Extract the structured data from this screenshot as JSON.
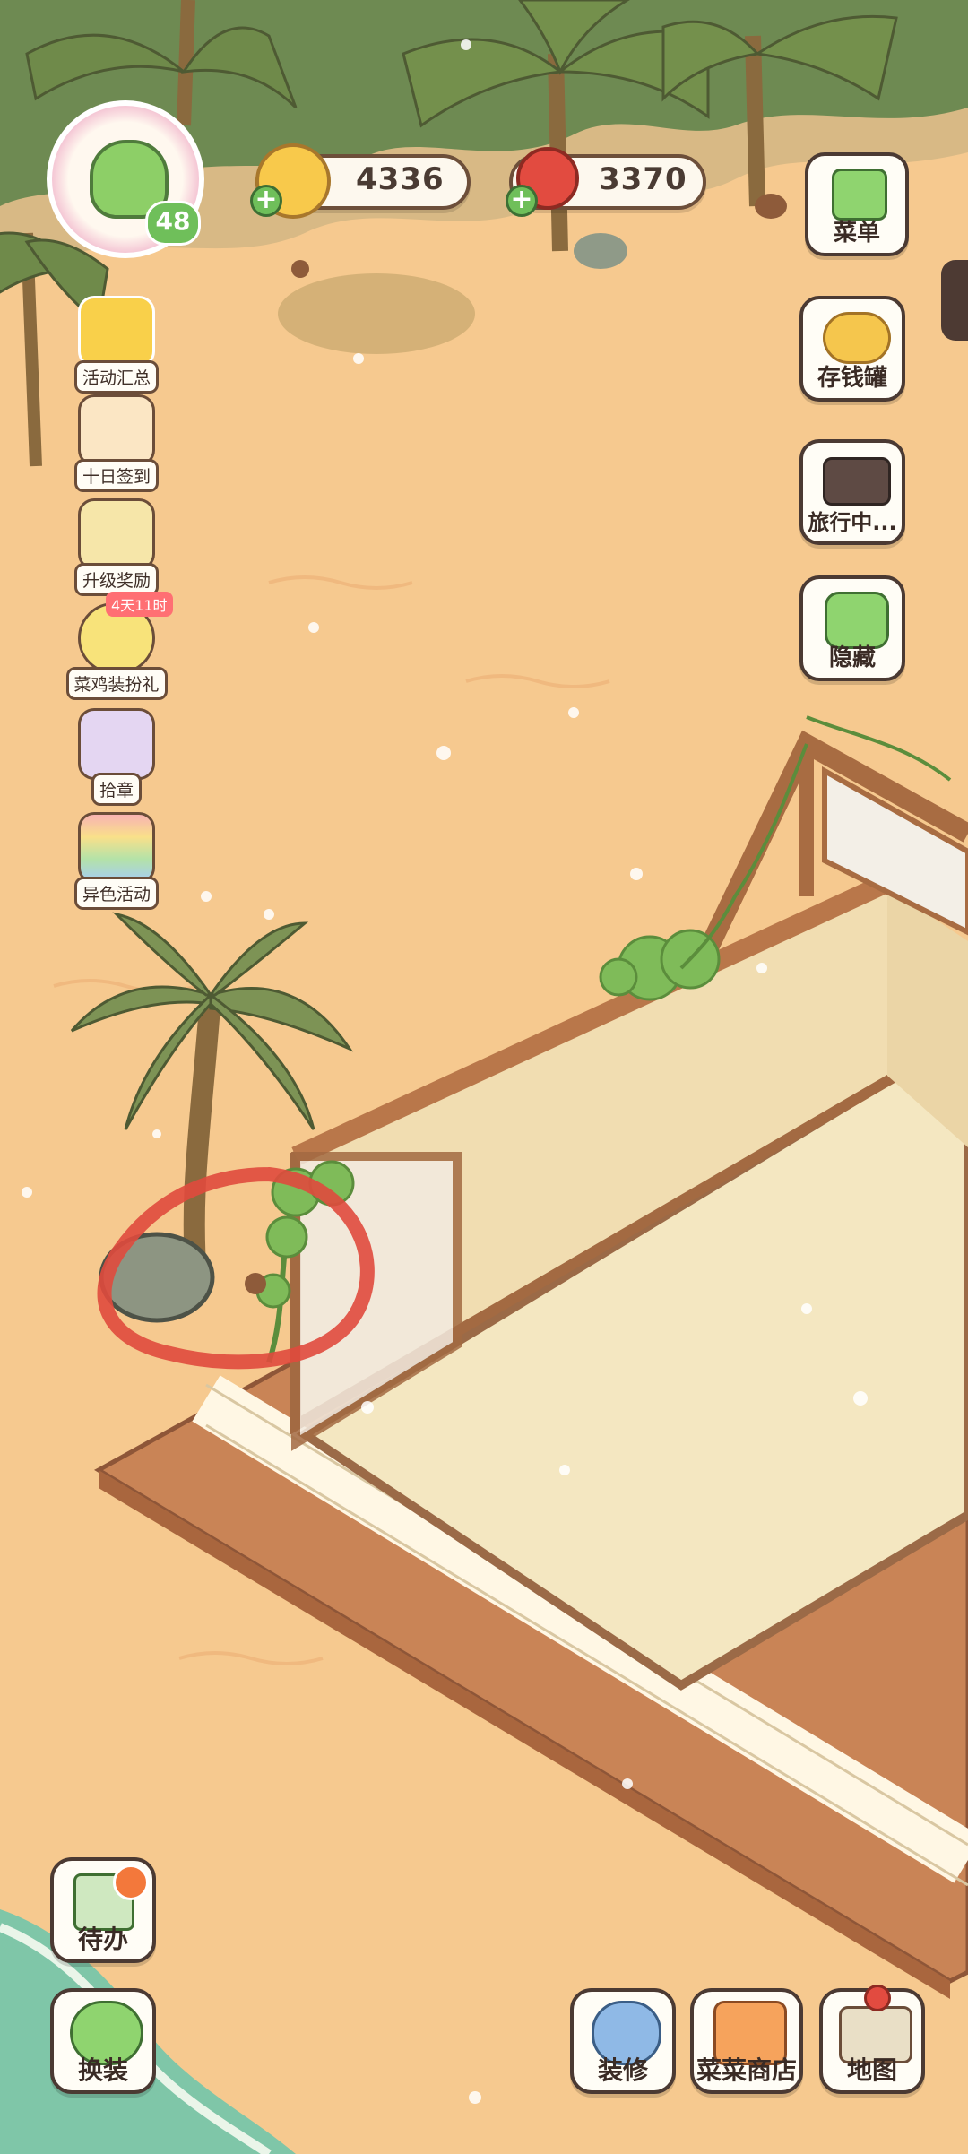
{
  "currency": {
    "coins": "4336",
    "hearts": "3370"
  },
  "player": {
    "level": "48",
    "avatar_icon": "green-mushroom-avatar-icon"
  },
  "left_menu": [
    {
      "label": "活动汇总",
      "icon": "crown-icon"
    },
    {
      "label": "十日签到",
      "icon": "calendar-icon"
    },
    {
      "label": "升级奖励",
      "icon": "gift-up-icon"
    },
    {
      "label": "菜鸡装扮礼",
      "icon": "chick-icon",
      "badge": "4天11时"
    },
    {
      "label": "拾章",
      "icon": "stamp-bag-icon"
    },
    {
      "label": "异色活动",
      "icon": "rainbow-book-icon"
    }
  ],
  "right_menu": [
    {
      "label": "菜单",
      "icon": "menu-icon"
    },
    {
      "label": "存钱罐",
      "icon": "piggy-bank-icon"
    },
    {
      "label": "旅行中...",
      "icon": "camera-icon"
    },
    {
      "label": "隐藏",
      "icon": "hide-frame-icon"
    }
  ],
  "bottom_left": [
    {
      "label": "待办",
      "icon": "todo-list-icon"
    },
    {
      "label": "换装",
      "icon": "outfit-icon"
    }
  ],
  "bottom_right": [
    {
      "label": "装修",
      "icon": "decorate-icon"
    },
    {
      "label": "菜菜商店",
      "icon": "shop-icon"
    },
    {
      "label": "地图",
      "icon": "map-icon"
    }
  ],
  "colors": {
    "sand": "#f6c98f",
    "floor": "#f4e7c1",
    "wood": "#b9774a",
    "wall": "#f1ddb1",
    "highlight_circle": "#e04a3d"
  }
}
